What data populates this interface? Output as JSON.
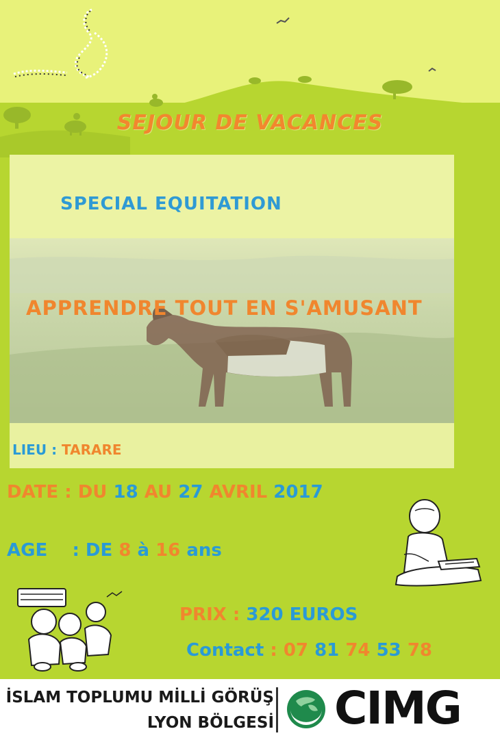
{
  "header": {
    "title": "SEJOUR DE VACANCES"
  },
  "banner": {
    "subtitle": "SPECIAL EQUITATION",
    "tagline": "APPRENDRE TOUT EN S'AMUSANT"
  },
  "details": {
    "lieu_label": "LIEU",
    "sep": ":",
    "lieu_value": "TARARE",
    "date_label": "DATE",
    "date_du": "DU",
    "date_d1": "18",
    "date_au": "AU",
    "date_d2": "27",
    "date_month": "AVRIL",
    "date_year": "2017",
    "age_label": "AGE",
    "age_de": "DE",
    "age_min": "8",
    "age_a": "à",
    "age_max": "16",
    "age_unit": "ans",
    "prix_label": "PRIX",
    "prix_value": "320 EUROS",
    "contact_label": "Contact",
    "phone": [
      "07",
      "81",
      "74",
      "53",
      "78"
    ]
  },
  "footer": {
    "org_line1": "İSLAM TOPLUMU MİLLİ GÖRÜŞ",
    "org_line2": "LYON BÖLGESİ",
    "logo_text": "CIMG"
  },
  "colors": {
    "top_band": "#e8f27a",
    "main_bg": "#b7d630",
    "orange": "#f0862e",
    "blue": "#2a9ad6"
  }
}
